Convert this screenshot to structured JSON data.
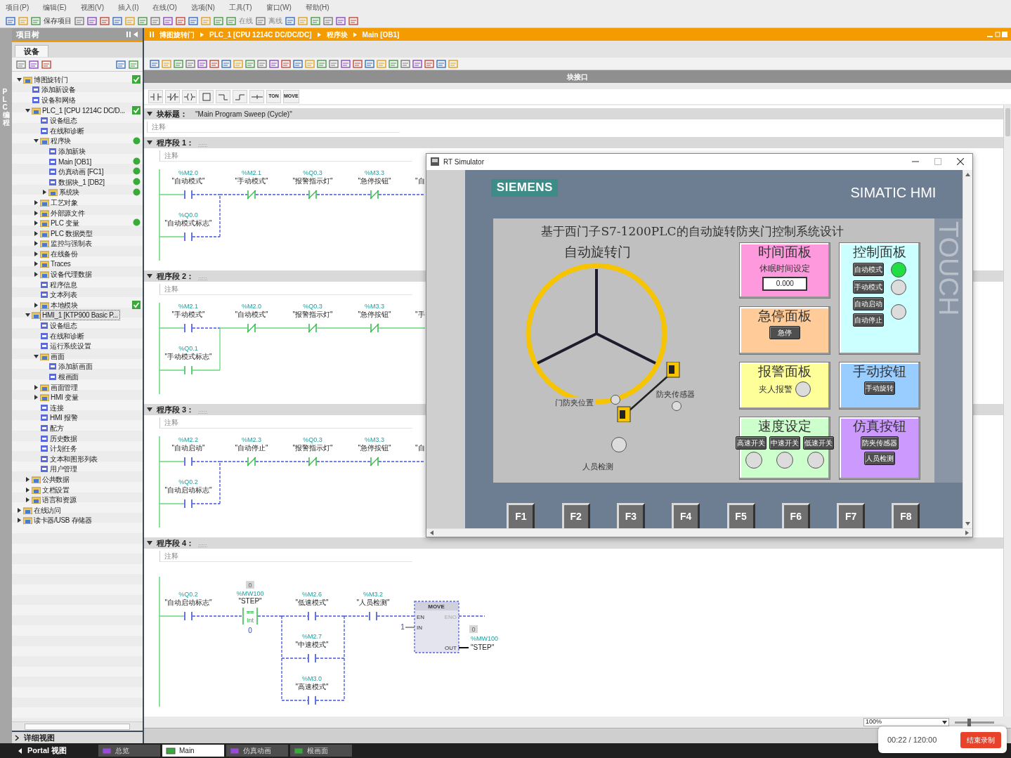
{
  "menu": [
    "项目(P)",
    "编辑(E)",
    "视图(V)",
    "插入(I)",
    "在线(O)",
    "选项(N)",
    "工具(T)",
    "窗口(W)",
    "帮助(H)"
  ],
  "toolbar": {
    "save": "保存项目",
    "online": "在线",
    "offline": "离线"
  },
  "side_strip": "PLC 编程",
  "project_tree": {
    "title": "项目树",
    "tab": "设备",
    "items": [
      {
        "label": "博图旋转门",
        "selected": false,
        "expanded": true,
        "status_check": true,
        "children": [
          {
            "label": "添加新设备",
            "selected": false
          },
          {
            "label": "设备和网络",
            "selected": false
          },
          {
            "label": "PLC_1 [CPU 1214C DC/D...",
            "selected": false,
            "expanded": true,
            "status_check": true,
            "children": [
              {
                "label": "设备组态",
                "selected": false
              },
              {
                "label": "在线和诊断",
                "selected": false
              },
              {
                "label": "程序块",
                "selected": false,
                "expanded": true,
                "status_dot": true,
                "children": [
                  {
                    "label": "添加新块",
                    "selected": false
                  },
                  {
                    "label": "Main [OB1]",
                    "selected": false,
                    "status_dot": true
                  },
                  {
                    "label": "仿真动画 [FC1]",
                    "selected": false,
                    "status_dot": true
                  },
                  {
                    "label": "数据块_1 [DB2]",
                    "selected": false,
                    "status_dot": true
                  },
                  {
                    "label": "系统块",
                    "selected": false,
                    "expanded": false,
                    "status_dot": true
                  }
                ]
              },
              {
                "label": "工艺对象",
                "selected": false,
                "expanded": false
              },
              {
                "label": "外部源文件",
                "selected": false,
                "expanded": false
              },
              {
                "label": "PLC 变量",
                "selected": false,
                "expanded": false,
                "status_dot": true
              },
              {
                "label": "PLC 数据类型",
                "selected": false,
                "expanded": false
              },
              {
                "label": "监控与强制表",
                "selected": false,
                "expanded": false
              },
              {
                "label": "在线备份",
                "selected": false,
                "expanded": false
              },
              {
                "label": "Traces",
                "selected": false,
                "expanded": false
              },
              {
                "label": "设备代理数据",
                "selected": false,
                "expanded": false
              },
              {
                "label": "程序信息",
                "selected": false
              },
              {
                "label": "文本列表",
                "selected": false
              },
              {
                "label": "本地模块",
                "selected": false,
                "expanded": false,
                "status_check": true
              }
            ]
          },
          {
            "label": "HMI_1 [KTP900 Basic P...",
            "selected": true,
            "expanded": true,
            "children": [
              {
                "label": "设备组态",
                "selected": false
              },
              {
                "label": "在线和诊断",
                "selected": false
              },
              {
                "label": "运行系统设置",
                "selected": false
              },
              {
                "label": "画面",
                "selected": false,
                "expanded": true,
                "children": [
                  {
                    "label": "添加新画面",
                    "selected": false
                  },
                  {
                    "label": "根画面",
                    "selected": false
                  }
                ]
              },
              {
                "label": "画面管理",
                "selected": false,
                "expanded": false
              },
              {
                "label": "HMI 变量",
                "selected": false,
                "expanded": false
              },
              {
                "label": "连接",
                "selected": false
              },
              {
                "label": "HMI 报警",
                "selected": false
              },
              {
                "label": "配方",
                "selected": false
              },
              {
                "label": "历史数据",
                "selected": false
              },
              {
                "label": "计划任务",
                "selected": false
              },
              {
                "label": "文本和图形列表",
                "selected": false
              },
              {
                "label": "用户管理",
                "selected": false
              }
            ]
          },
          {
            "label": "公共数据",
            "selected": false,
            "expanded": false
          },
          {
            "label": "文档设置",
            "selected": false,
            "expanded": false
          },
          {
            "label": "语言和资源",
            "selected": false,
            "expanded": false
          }
        ]
      },
      {
        "label": "在线访问",
        "selected": false,
        "expanded": false
      },
      {
        "label": "读卡器/USB 存储器",
        "selected": false,
        "expanded": false
      }
    ],
    "details": "详细视图"
  },
  "breadcrumb": [
    "博图旋转门",
    "PLC_1 [CPU 1214C DC/DC/DC]",
    "程序块",
    "Main [OB1]"
  ],
  "interface_bar": "块接口",
  "instructions": [
    {
      "kind": "no"
    },
    {
      "kind": "nc"
    },
    {
      "kind": "coil"
    },
    {
      "kind": "box"
    },
    {
      "kind": "branch_open"
    },
    {
      "kind": "branch_close"
    },
    {
      "kind": "wire"
    },
    {
      "kind": "label",
      "text": "TON"
    },
    {
      "kind": "label",
      "text": "MOVE"
    }
  ],
  "block": {
    "title_label": "块标题：",
    "title": "\"Main Program Sweep (Cycle)\"",
    "comment": "注释"
  },
  "networks": [
    {
      "kind": "interlock",
      "title": "程序段 1：",
      "placeholder": ".....",
      "comment": "注释",
      "contacts": [
        {
          "address": "%M2.0",
          "tag": "\"自动模式\"",
          "kind": "no",
          "closed": false
        },
        {
          "address": "%M2.1",
          "tag": "\"手动模式\"",
          "kind": "nc",
          "closed": true
        },
        {
          "address": "%Q0.3",
          "tag": "\"报警指示灯\"",
          "kind": "nc",
          "closed": true
        },
        {
          "address": "%M3.3",
          "tag": "\"急停按钮\"",
          "kind": "nc",
          "closed": true
        }
      ],
      "branch": {
        "address": "%Q0.0",
        "tag": "\"自动模式标志\"",
        "kind": "no",
        "closed": false
      },
      "cut_label": "\"自"
    },
    {
      "kind": "interlock",
      "title": "程序段 2：",
      "placeholder": ".....",
      "comment": "注释",
      "contacts": [
        {
          "address": "%M2.1",
          "tag": "\"手动模式\"",
          "kind": "no",
          "closed": false
        },
        {
          "address": "%M2.0",
          "tag": "\"自动模式\"",
          "kind": "nc",
          "closed": true
        },
        {
          "address": "%Q0.3",
          "tag": "\"报警指示灯\"",
          "kind": "nc",
          "closed": true
        },
        {
          "address": "%M3.3",
          "tag": "\"急停按钮\"",
          "kind": "nc",
          "closed": true
        }
      ],
      "branch": {
        "address": "%Q0.1",
        "tag": "\"手动模式标志\"",
        "kind": "no",
        "closed": true
      },
      "cut_label": "\"手"
    },
    {
      "kind": "interlock",
      "title": "程序段 3：",
      "placeholder": ".....",
      "comment": "注释",
      "contacts": [
        {
          "address": "%M2.2",
          "tag": "\"自动启动\"",
          "kind": "no",
          "closed": false
        },
        {
          "address": "%M2.3",
          "tag": "\"自动停止\"",
          "kind": "nc",
          "closed": true
        },
        {
          "address": "%Q0.3",
          "tag": "\"报警指示灯\"",
          "kind": "nc",
          "closed": true
        },
        {
          "address": "%M3.3",
          "tag": "\"急停按钮\"",
          "kind": "nc",
          "closed": true
        }
      ],
      "branch": {
        "address": "%Q0.2",
        "tag": "\"自动启动标志\"",
        "kind": "no",
        "closed": false
      },
      "cut_label": "\"自"
    },
    {
      "kind": "move_chain",
      "title": "程序段 4：",
      "placeholder": ".....",
      "comment": "注释",
      "first": {
        "address": "%Q0.2",
        "tag": "\"自动启动标志\"",
        "kind": "no",
        "closed": false
      },
      "compare": {
        "watch": "0",
        "address": "%MW100",
        "tag": "\"STEP\"",
        "op": "==",
        "type": "Int",
        "operand": "0"
      },
      "parallel": [
        {
          "address": "%M2.6",
          "tag": "\"低速模式\"",
          "kind": "no",
          "closed": false
        },
        {
          "address": "%M2.7",
          "tag": "\"中速模式\"",
          "kind": "no",
          "closed": false
        },
        {
          "address": "%M3.0",
          "tag": "\"高速模式\"",
          "kind": "no",
          "closed": false
        }
      ],
      "after": {
        "address": "%M3.2",
        "tag": "\"人员检测\"",
        "kind": "no",
        "closed": false
      },
      "move": {
        "name": "MOVE",
        "en": "EN",
        "eno": "ENO",
        "in_pin": "IN",
        "out_pin": "OUT",
        "in_value": "1",
        "out_watch": "0",
        "out_address": "%MW100",
        "out_tag": "\"STEP\""
      }
    }
  ],
  "zoom": {
    "value": "100%",
    "level": 0.35
  },
  "simulator": {
    "title": "RT Simulator",
    "brand": "SIEMENS",
    "model": "SIMATIC HMI",
    "touch": "TOUCH",
    "screen_title": "基于西门子S7-1200PLC的自动旋转防夹门控制系统设计",
    "door_title": "自动旋转门",
    "indicators": [
      {
        "label": "门防夹位置",
        "on": false
      },
      {
        "label": "防夹传感器",
        "on": false
      },
      {
        "label": "人员检测",
        "on": false
      }
    ],
    "panels": [
      {
        "title": "时间面板",
        "color": "#ff99dd",
        "rows": [
          [
            {
              "kind": "text",
              "text": "休眠时间设定"
            }
          ],
          [
            {
              "kind": "field",
              "value": "0.000"
            }
          ]
        ]
      },
      {
        "title": "控制面板",
        "color": "#ccffff",
        "rows": [
          [
            {
              "kind": "button",
              "text": "自动模式"
            },
            {
              "kind": "lamp",
              "on": true
            }
          ],
          [
            {
              "kind": "button",
              "text": "手动模式"
            },
            {
              "kind": "lamp",
              "on": false
            }
          ],
          [
            {
              "kind": "stack",
              "buttons": [
                "自动启动",
                "自动停止"
              ]
            },
            {
              "kind": "lamp",
              "on": false
            }
          ]
        ]
      },
      {
        "title": "急停面板",
        "color": "#ffcc99",
        "rows": [
          [
            {
              "kind": "button",
              "text": "急停"
            }
          ]
        ]
      },
      {
        "title": "报警面板",
        "color": "#ffff99",
        "rows": [
          [
            {
              "kind": "text",
              "text": "夹人报警"
            },
            {
              "kind": "lamp",
              "on": false
            }
          ]
        ]
      },
      {
        "title": "手动按钮",
        "color": "#99ccff",
        "rows": [
          [
            {
              "kind": "button",
              "text": "手动旋转"
            }
          ]
        ]
      },
      {
        "title": "速度设定",
        "color": "#ccffcc",
        "rows": [
          [
            {
              "kind": "button",
              "text": "高速开关"
            },
            {
              "kind": "button",
              "text": "中速开关"
            },
            {
              "kind": "button",
              "text": "低速开关"
            }
          ],
          [
            {
              "kind": "lamp",
              "on": false
            },
            {
              "kind": "lamp",
              "on": false
            },
            {
              "kind": "lamp",
              "on": false
            }
          ]
        ]
      },
      {
        "title": "仿真按钮",
        "color": "#cc99ff",
        "rows": [
          [
            {
              "kind": "button",
              "text": "防夹传感器"
            }
          ],
          [
            {
              "kind": "button",
              "text": "人员检测"
            }
          ]
        ]
      }
    ],
    "function_keys": [
      "F1",
      "F2",
      "F3",
      "F4",
      "F5",
      "F6",
      "F7",
      "F8"
    ]
  },
  "taskbar": {
    "portal": "Portal 视图",
    "tabs": [
      {
        "label": "总览",
        "selected": false
      },
      {
        "label": "Main",
        "selected": true
      },
      {
        "label": "仿真动画",
        "selected": false
      },
      {
        "label": "根画面",
        "selected": false
      }
    ]
  },
  "recorder": {
    "time": "00:22 / 120:00",
    "button": "结束录制"
  }
}
